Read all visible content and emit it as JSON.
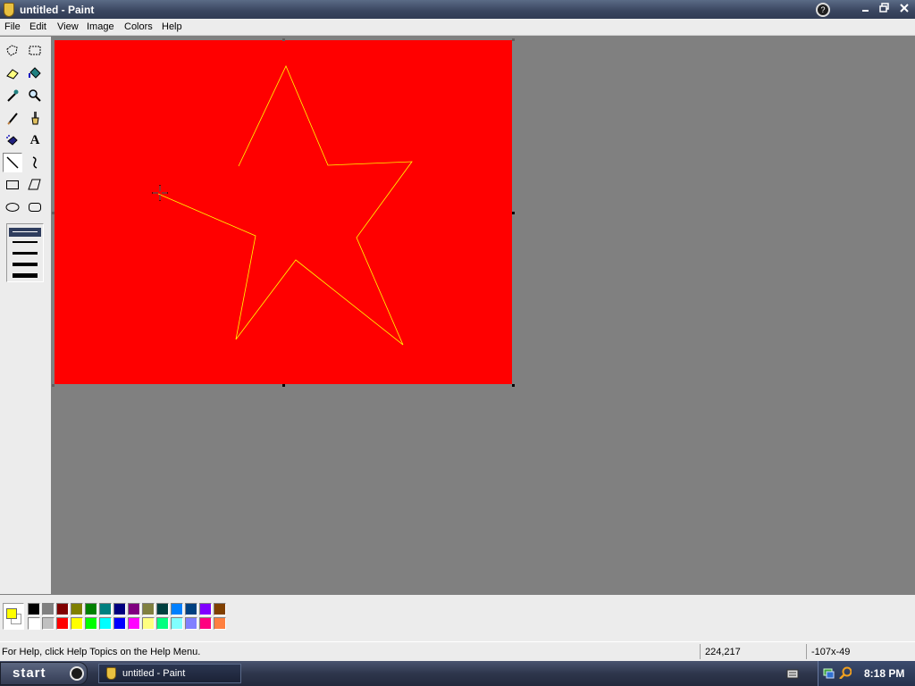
{
  "window": {
    "title": "untitled - Paint",
    "app_icon": "paint-icon",
    "controls": [
      "help-icon",
      "minimize-icon",
      "restore-icon",
      "close-icon"
    ]
  },
  "menu": [
    "File",
    "Edit",
    "View",
    "Image",
    "Colors",
    "Help"
  ],
  "toolbox": {
    "tools": [
      {
        "name": "free-form-select-icon"
      },
      {
        "name": "select-icon"
      },
      {
        "name": "eraser-icon"
      },
      {
        "name": "fill-bucket-icon"
      },
      {
        "name": "pick-color-icon"
      },
      {
        "name": "magnifier-icon"
      },
      {
        "name": "pencil-icon"
      },
      {
        "name": "brush-icon"
      },
      {
        "name": "airbrush-icon"
      },
      {
        "name": "text-icon",
        "glyph": "A"
      },
      {
        "name": "line-icon",
        "selected": true
      },
      {
        "name": "curve-icon"
      },
      {
        "name": "rectangle-icon"
      },
      {
        "name": "polygon-icon"
      },
      {
        "name": "ellipse-icon"
      },
      {
        "name": "rounded-rectangle-icon"
      }
    ],
    "line_widths": [
      1,
      2,
      3,
      4,
      5
    ],
    "selected_line_width": 1
  },
  "canvas": {
    "background_color": "#ff0000",
    "stroke_color": "#ffff00"
  },
  "palette": {
    "foreground": "#ffff00",
    "background": "#ffffff",
    "row1": [
      "#000000",
      "#808080",
      "#800000",
      "#808000",
      "#008000",
      "#008080",
      "#000080",
      "#800080",
      "#808040",
      "#004040",
      "#0080ff",
      "#004080",
      "#8000ff",
      "#804000"
    ],
    "row2": [
      "#ffffff",
      "#c0c0c0",
      "#ff0000",
      "#ffff00",
      "#00ff00",
      "#00ffff",
      "#0000ff",
      "#ff00ff",
      "#ffff80",
      "#00ff80",
      "#80ffff",
      "#8080ff",
      "#ff0080",
      "#ff8040"
    ]
  },
  "status": {
    "help": "For Help, click Help Topics on the Help Menu.",
    "position": "224,217",
    "size": "-107x-49"
  },
  "taskbar": {
    "start_label": "start",
    "task_label": "untitled - Paint",
    "clock": "8:18 PM"
  }
}
